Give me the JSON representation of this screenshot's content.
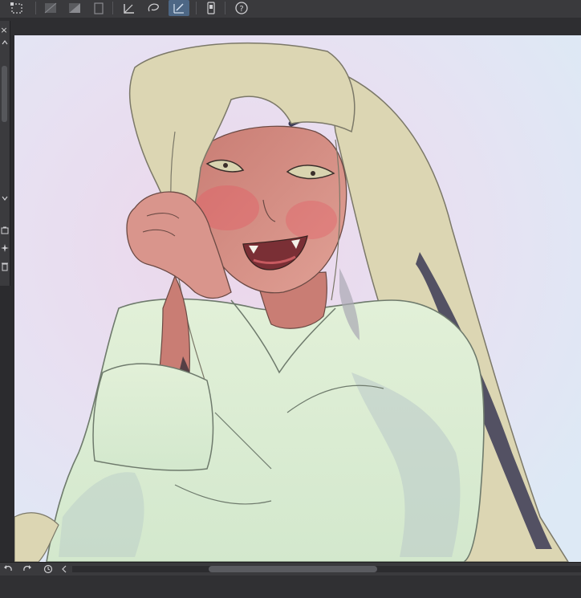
{
  "app": {
    "accent": "#4d6785",
    "panel_bg": "#3a3a3d"
  },
  "toolbar": {
    "buttons": [
      {
        "name": "transform-icon"
      },
      {
        "name": "clear-icon"
      },
      {
        "name": "fill-icon"
      },
      {
        "name": "clipboard-icon"
      },
      {
        "name": "ruler-icon"
      },
      {
        "name": "lasso-icon"
      },
      {
        "name": "pen-icon",
        "active": true
      },
      {
        "name": "phone-icon"
      },
      {
        "name": "help-icon"
      }
    ]
  },
  "left_panel": {
    "close_glyph": "×",
    "icons": [
      "collapse-up-icon",
      "collapse-down-icon",
      "layer-icon",
      "star-icon",
      "trash-icon"
    ]
  },
  "canvas": {
    "description_colors": {
      "bg_top": "#e7edf7",
      "bg_mid": "#ecd9ea",
      "bg_bottom": "#dde8f3",
      "hair": "#ddd8b6",
      "skin": "#d9958c",
      "shirt": "#d8ebd1"
    }
  },
  "bottom_bar": {
    "icons": [
      "undo-icon",
      "redo-icon",
      "history-icon",
      "chevron-left-icon"
    ]
  }
}
